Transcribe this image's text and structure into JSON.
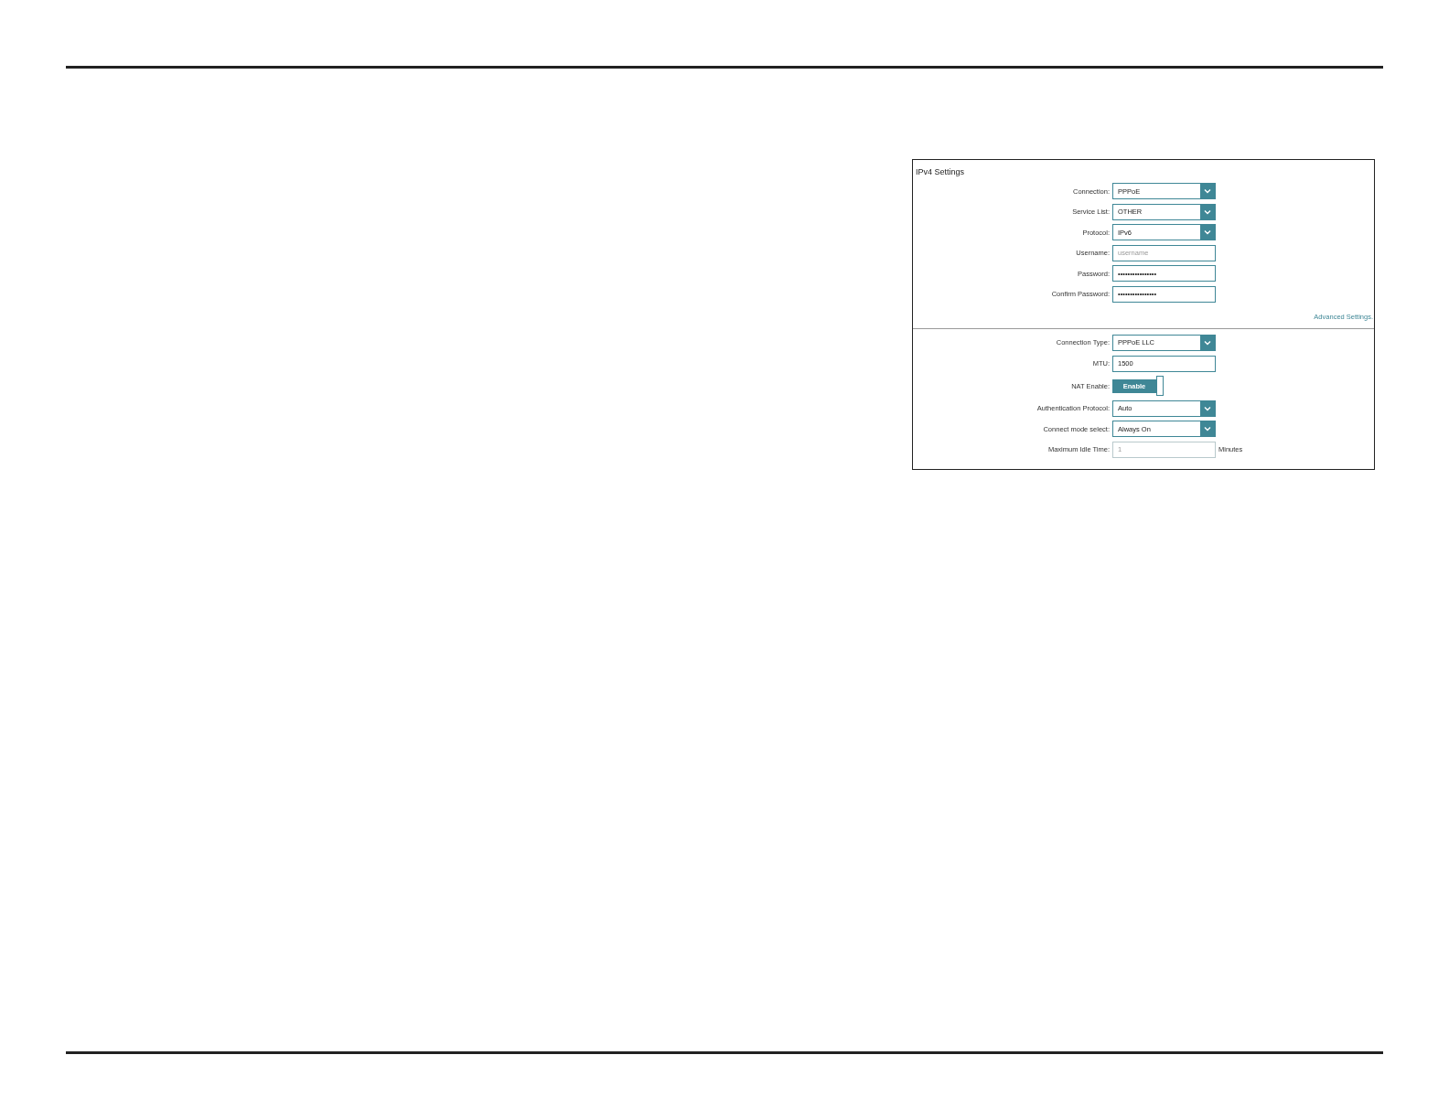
{
  "panel": {
    "title": "IPv4 Settings",
    "sections": [
      {
        "fields": [
          {
            "kind": "select",
            "label": "Connection:",
            "value": "PPPoE"
          },
          {
            "kind": "select",
            "label": "Service List:",
            "value": "OTHER"
          },
          {
            "kind": "select",
            "label": "Protocol:",
            "value": "IPv6"
          },
          {
            "kind": "text",
            "label": "Username:",
            "placeholder": "username"
          },
          {
            "kind": "text",
            "label": "Password:",
            "value": "••••••••••••••••"
          },
          {
            "kind": "text",
            "label": "Confirm Password:",
            "value": "••••••••••••••••"
          }
        ],
        "link": "Advanced Settings."
      },
      {
        "fields": [
          {
            "kind": "select",
            "label": "Connection Type:",
            "value": "PPPoE LLC"
          },
          {
            "kind": "text",
            "label": "MTU:",
            "value": "1500"
          },
          {
            "kind": "toggle",
            "label": "NAT Enable:",
            "text": "Enable",
            "on": true
          },
          {
            "kind": "select",
            "label": "Authentication Protocol:",
            "value": "Auto"
          },
          {
            "kind": "select",
            "label": "Connect mode select:",
            "value": "Always On"
          },
          {
            "kind": "text",
            "label": "Maximum Idle Time:",
            "value": "1",
            "disabled": true,
            "unit": "Minutes"
          }
        ]
      }
    ]
  }
}
